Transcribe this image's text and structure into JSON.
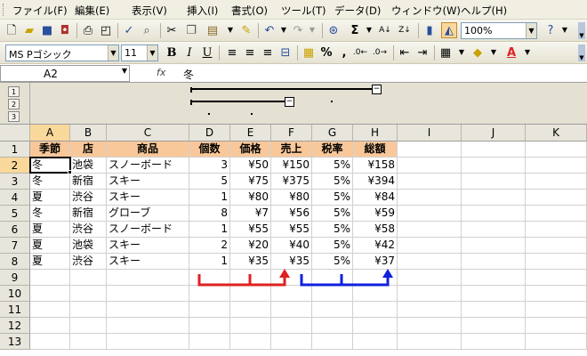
{
  "menu": [
    "ファイル(F)",
    "編集(E)",
    "表示(V)",
    "挿入(I)",
    "書式(O)",
    "ツール(T)",
    "データ(D)",
    "ウィンドウ(W)",
    "ヘルプ(H)"
  ],
  "toolbar": {
    "zoom": "100%"
  },
  "format_toolbar": {
    "font_name": "MS Pゴシック",
    "font_size": "11",
    "bold": "B",
    "italic": "I",
    "underline": "U",
    "percent": "%"
  },
  "formula_bar": {
    "name_box": "A2",
    "fx": "fx",
    "value": "冬"
  },
  "outline": {
    "levels": [
      "1",
      "2",
      "3"
    ],
    "collapse": "−"
  },
  "sheet": {
    "columns": [
      "A",
      "B",
      "C",
      "D",
      "E",
      "F",
      "G",
      "H",
      "I",
      "J",
      "K"
    ],
    "rows": [
      "1",
      "2",
      "3",
      "4",
      "5",
      "6",
      "7",
      "8",
      "9",
      "10",
      "11",
      "12",
      "13"
    ],
    "headers": [
      "季節",
      "店",
      "商品",
      "個数",
      "価格",
      "売上",
      "税率",
      "総額"
    ],
    "data": [
      [
        "冬",
        "池袋",
        "スノーボード",
        "3",
        "¥50",
        "¥150",
        "5%",
        "¥158"
      ],
      [
        "冬",
        "新宿",
        "スキー",
        "5",
        "¥75",
        "¥375",
        "5%",
        "¥394"
      ],
      [
        "夏",
        "渋谷",
        "スキー",
        "1",
        "¥80",
        "¥80",
        "5%",
        "¥84"
      ],
      [
        "冬",
        "新宿",
        "グローブ",
        "8",
        "¥7",
        "¥56",
        "5%",
        "¥59"
      ],
      [
        "夏",
        "渋谷",
        "スノーボード",
        "1",
        "¥55",
        "¥55",
        "5%",
        "¥58"
      ],
      [
        "夏",
        "池袋",
        "スキー",
        "2",
        "¥20",
        "¥40",
        "5%",
        "¥42"
      ],
      [
        "夏",
        "渋谷",
        "スキー",
        "1",
        "¥35",
        "¥35",
        "5%",
        "¥37"
      ]
    ]
  },
  "colors": {
    "header_fill": "#f9c89a",
    "selected_header": "#f9d89b",
    "red_arrow": "#e02020",
    "blue_arrow": "#1020e0"
  }
}
